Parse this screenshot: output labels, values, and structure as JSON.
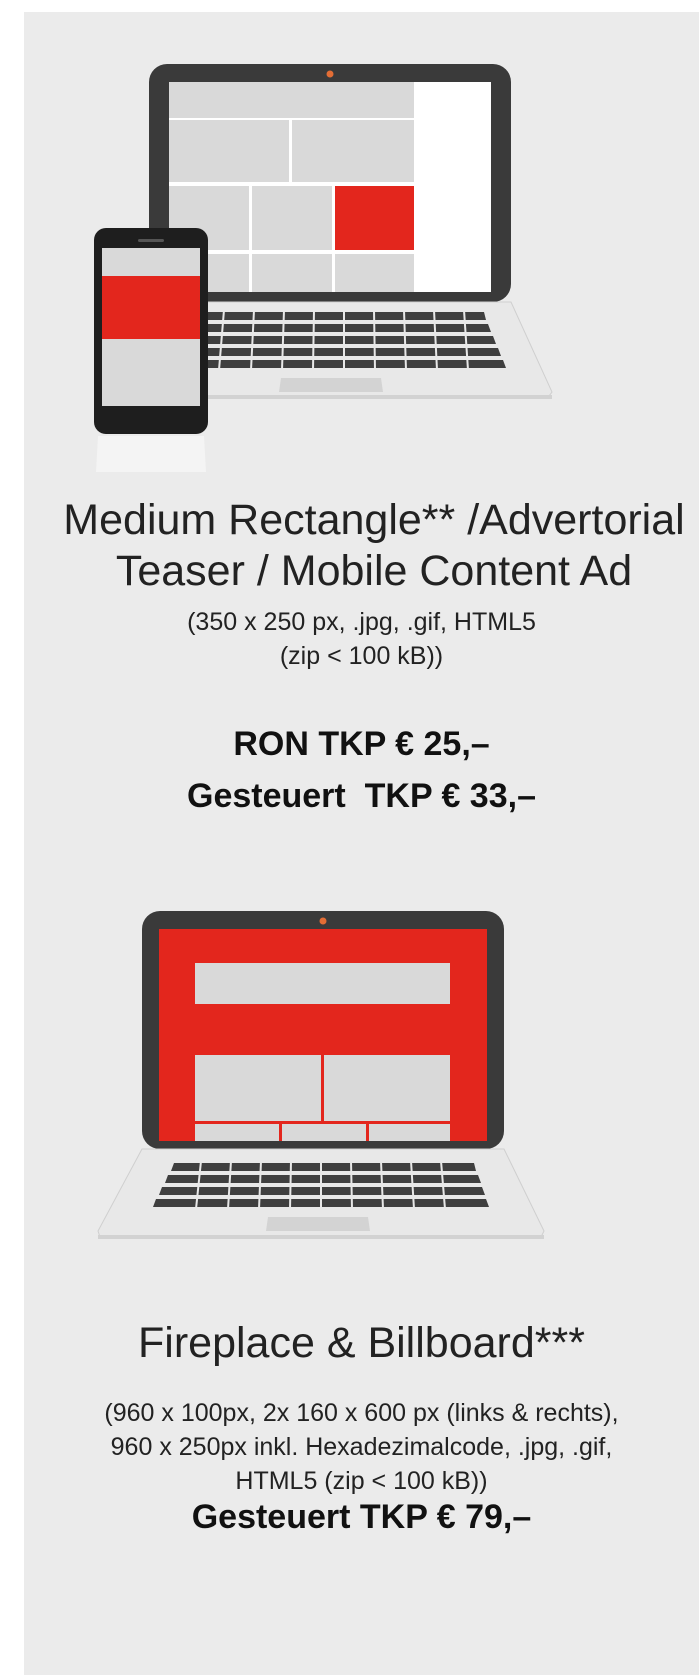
{
  "colors": {
    "panel_bg": "#ebebeb",
    "accent_red": "#e3261d",
    "device_frame": "#3a3a3a",
    "screen_tile": "#d9d9d9",
    "text": "#222222"
  },
  "offers": [
    {
      "icon": "laptop-and-phone-medium-rectangle-icon",
      "title": "Medium Rectangle** /Advertorial\nTeaser / Mobile Content Ad",
      "specs": "(350 x 250 px, .jpg, .gif, HTML5\n(zip < 100 kB))",
      "price_lines": [
        "RON TKP € 25,–",
        "Gesteuert  TKP € 33,–"
      ]
    },
    {
      "icon": "laptop-fireplace-billboard-icon",
      "title": "Fireplace & Billboard***",
      "specs": "(960 x 100px, 2x 160 x 600 px (links & rechts),\n960 x 250px inkl. Hexadezimalcode, .jpg, .gif,\nHTML5 (zip < 100 kB))",
      "price_lines": [
        "Gesteuert TKP € 79,–"
      ]
    }
  ]
}
